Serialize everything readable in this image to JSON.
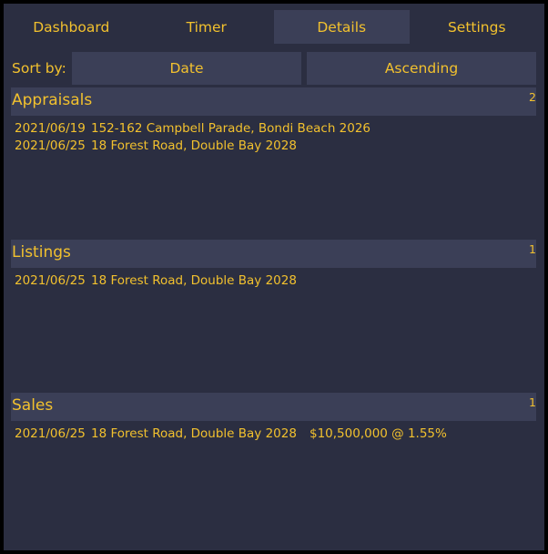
{
  "tabs": [
    {
      "label": "Dashboard"
    },
    {
      "label": "Timer"
    },
    {
      "label": "Details"
    },
    {
      "label": "Settings"
    }
  ],
  "active_tab": "Details",
  "sort": {
    "label": "Sort by:",
    "field": "Date",
    "order": "Ascending"
  },
  "sections": {
    "appraisals": {
      "title": "Appraisals",
      "count": "2",
      "rows": [
        {
          "date": "2021/06/19",
          "address": "152-162 Campbell Parade, Bondi Beach 2026"
        },
        {
          "date": "2021/06/25",
          "address": "18 Forest Road, Double Bay 2028"
        }
      ]
    },
    "listings": {
      "title": "Listings",
      "count": "1",
      "rows": [
        {
          "date": "2021/06/25",
          "address": "18 Forest Road, Double Bay 2028"
        }
      ]
    },
    "sales": {
      "title": "Sales",
      "count": "1",
      "rows": [
        {
          "date": "2021/06/25",
          "address": "18 Forest Road, Double Bay 2028",
          "amount": "$10,500,000 @ 1.55%"
        }
      ]
    }
  },
  "colors": {
    "text": "#f2c12e",
    "background": "#2b2e41",
    "surface": "#3b3f57"
  }
}
